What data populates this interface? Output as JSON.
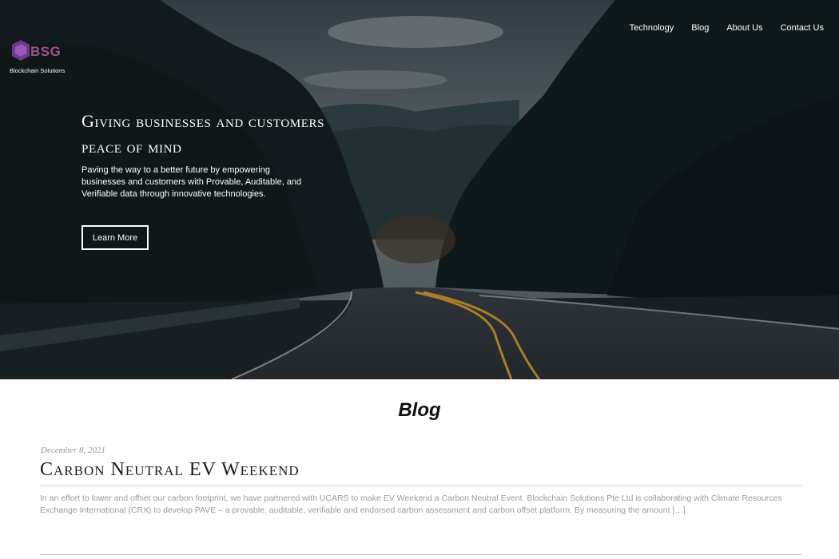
{
  "brand": {
    "logo_text": "BSG",
    "tagline": "Blockchain Solutions",
    "accent": "#a0508e"
  },
  "nav": {
    "items": [
      {
        "label": "Technology"
      },
      {
        "label": "Blog"
      },
      {
        "label": "About Us"
      },
      {
        "label": "Contact Us"
      }
    ]
  },
  "hero": {
    "title_line1": "Giving businesses and customers",
    "title_line2": "peace of mind",
    "description": "Paving the way to a better future by empowering businesses and customers with Provable, Auditable, and Verifiable data through innovative technologies.",
    "button_label": "Learn More"
  },
  "blog": {
    "heading": "Blog",
    "posts": [
      {
        "date": "December 8, 2021",
        "title": "Carbon Neutral EV Weekend",
        "excerpt": "In an effort to lower and offset our carbon footprint, we have partnered with UCARS to make EV Weekend a Carbon Neutral Event.  Blockchain Solutions Pte Ltd is collaborating with Climate Resources Exchange International (CRX) to develop PAVE – a provable, auditable, verifiable and endorsed carbon assessment and carbon offset platform. By measuring the amount […]"
      }
    ]
  }
}
